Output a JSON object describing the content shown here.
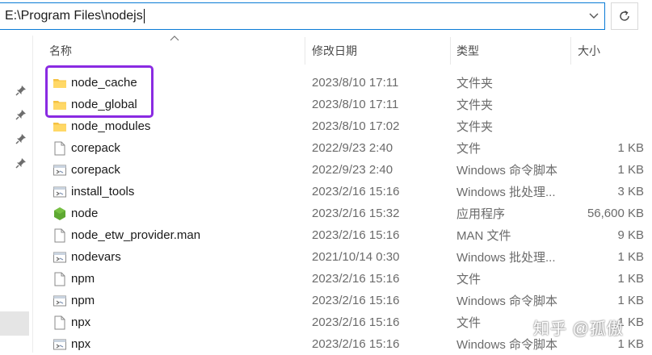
{
  "address": {
    "path": "E:\\Program Files\\nodejs"
  },
  "icons": {
    "dropdown": "chevron-down-icon",
    "refresh": "refresh-icon",
    "pin": "pin-icon"
  },
  "columns": {
    "name": "名称",
    "date": "修改日期",
    "type": "类型",
    "size": "大小"
  },
  "files": [
    {
      "name": "node_cache",
      "date": "2023/8/10 17:11",
      "type": "文件夹",
      "size": "",
      "icon": "folder-icon"
    },
    {
      "name": "node_global",
      "date": "2023/8/10 17:11",
      "type": "文件夹",
      "size": "",
      "icon": "folder-icon"
    },
    {
      "name": "node_modules",
      "date": "2023/8/10 17:02",
      "type": "文件夹",
      "size": "",
      "icon": "folder-icon"
    },
    {
      "name": "corepack",
      "date": "2022/9/23 2:40",
      "type": "文件",
      "size": "1 KB",
      "icon": "file-icon"
    },
    {
      "name": "corepack",
      "date": "2022/9/23 2:40",
      "type": "Windows 命令脚本",
      "size": "1 KB",
      "icon": "script-icon"
    },
    {
      "name": "install_tools",
      "date": "2023/2/16 15:16",
      "type": "Windows 批处理...",
      "size": "3 KB",
      "icon": "script-icon"
    },
    {
      "name": "node",
      "date": "2023/2/16 15:32",
      "type": "应用程序",
      "size": "56,600 KB",
      "icon": "nodejs-icon"
    },
    {
      "name": "node_etw_provider.man",
      "date": "2023/2/16 15:16",
      "type": "MAN 文件",
      "size": "9 KB",
      "icon": "file-icon"
    },
    {
      "name": "nodevars",
      "date": "2021/10/14 0:30",
      "type": "Windows 批处理...",
      "size": "1 KB",
      "icon": "script-icon"
    },
    {
      "name": "npm",
      "date": "2023/2/16 15:16",
      "type": "文件",
      "size": "1 KB",
      "icon": "file-icon"
    },
    {
      "name": "npm",
      "date": "2023/2/16 15:16",
      "type": "Windows 命令脚本",
      "size": "1 KB",
      "icon": "script-icon"
    },
    {
      "name": "npx",
      "date": "2023/2/16 15:16",
      "type": "文件",
      "size": "1 KB",
      "icon": "file-icon"
    },
    {
      "name": "npx",
      "date": "2023/2/16 15:16",
      "type": "Windows 命令脚本",
      "size": "1 KB",
      "icon": "script-icon"
    }
  ],
  "watermark": "知乎 @孤傲",
  "colors": {
    "highlight": "#8a2be2",
    "folder": "#f5c242",
    "node": "#5ea832",
    "focus_border": "#0a7bd6"
  }
}
